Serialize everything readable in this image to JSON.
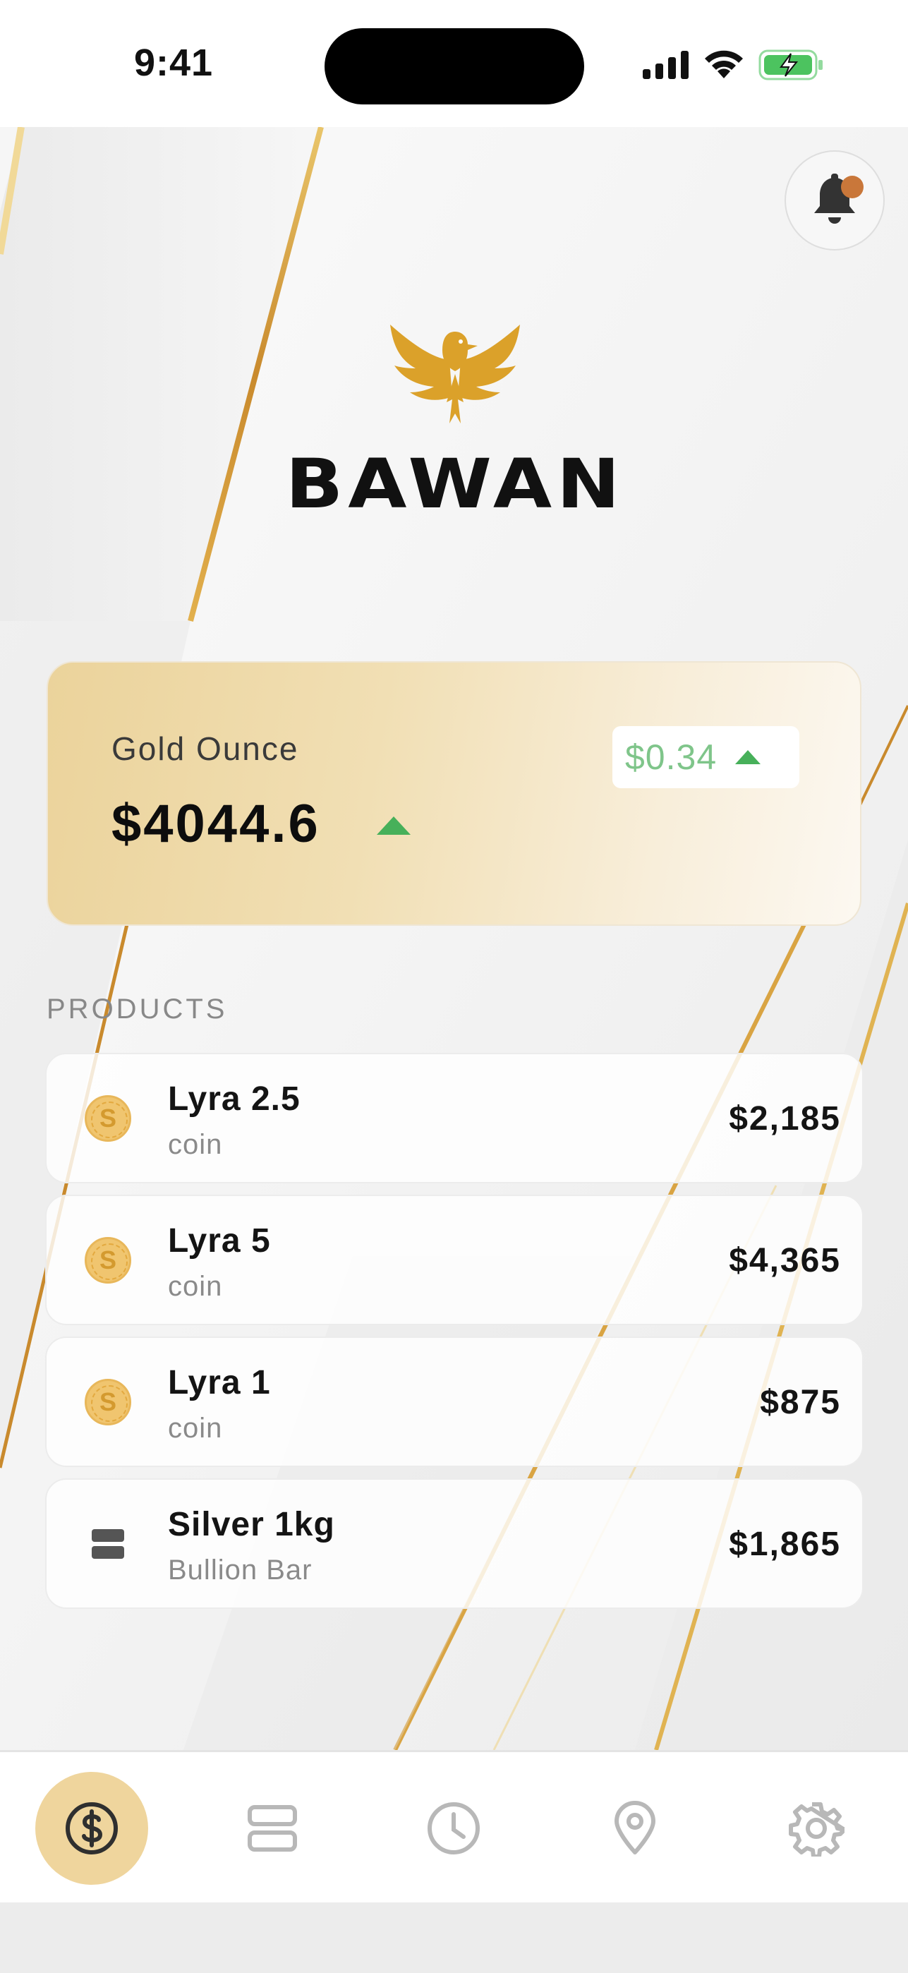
{
  "status_bar": {
    "time": "9:41"
  },
  "brand": {
    "name": "BAWAN"
  },
  "gold_card": {
    "label": "Gold Ounce",
    "price": "$4044.6",
    "change": "$0.34",
    "trend": "up"
  },
  "products": {
    "section_title": "PRODUCTS",
    "items": [
      {
        "name": "Lyra 2.5",
        "type": "coin",
        "price": "$2,185",
        "icon": "coin-icon"
      },
      {
        "name": "Lyra 5",
        "type": "coin",
        "price": "$4,365",
        "icon": "coin-icon"
      },
      {
        "name": "Lyra 1",
        "type": "coin",
        "price": "$875",
        "icon": "coin-icon"
      },
      {
        "name": "Silver 1kg",
        "type": "Bullion Bar",
        "price": "$1,865",
        "icon": "bullion-bar-icon"
      }
    ]
  },
  "bottom_nav": {
    "items": [
      {
        "icon": "dollar-icon",
        "active": true
      },
      {
        "icon": "products-icon",
        "active": false
      },
      {
        "icon": "clock-icon",
        "active": false
      },
      {
        "icon": "location-pin-icon",
        "active": false
      },
      {
        "icon": "gear-icon",
        "active": false
      }
    ]
  },
  "colors": {
    "accent_gold": "#efd59d",
    "positive": "#47b05a",
    "notification_dot": "#c9773a"
  }
}
